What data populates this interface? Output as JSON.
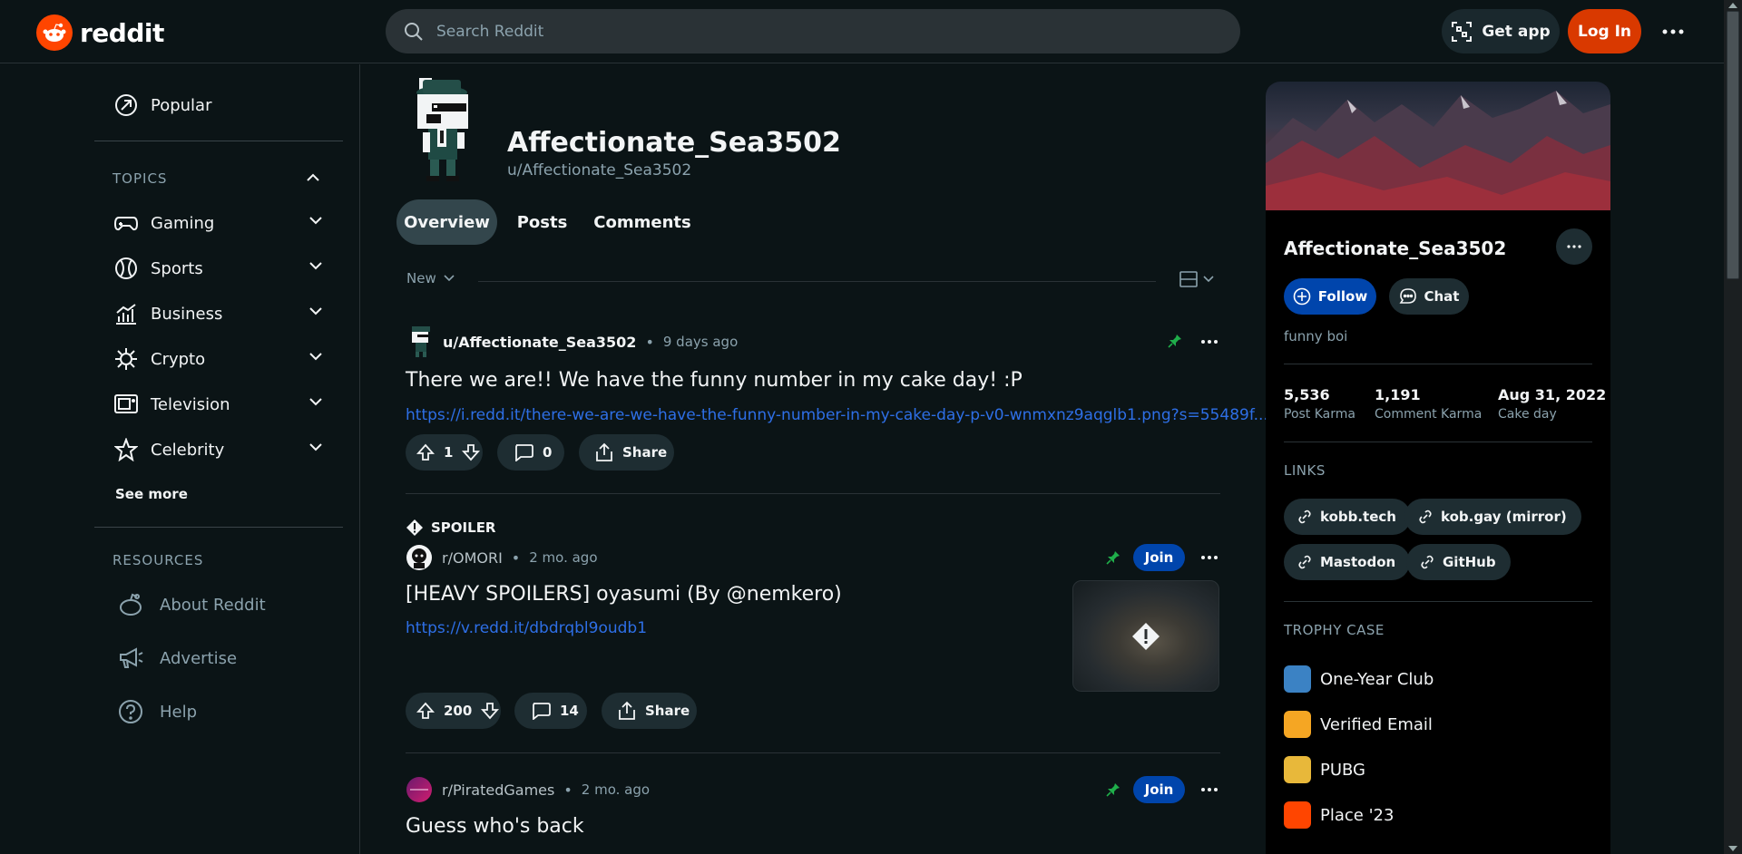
{
  "header": {
    "logo_text": "reddit",
    "search_placeholder": "Search Reddit",
    "get_app_label": "Get app",
    "login_label": "Log In"
  },
  "sidebar": {
    "popular_label": "Popular",
    "topics_heading": "TOPICS",
    "topics": [
      {
        "label": "Gaming",
        "icon": "gamepad-icon"
      },
      {
        "label": "Sports",
        "icon": "ball-icon"
      },
      {
        "label": "Business",
        "icon": "chart-icon"
      },
      {
        "label": "Crypto",
        "icon": "crypto-icon"
      },
      {
        "label": "Television",
        "icon": "tv-icon"
      },
      {
        "label": "Celebrity",
        "icon": "star-icon"
      }
    ],
    "see_more_label": "See more",
    "resources_heading": "RESOURCES",
    "resources": [
      {
        "label": "About Reddit",
        "icon": "reddit-alien-icon"
      },
      {
        "label": "Advertise",
        "icon": "megaphone-icon"
      },
      {
        "label": "Help",
        "icon": "help-icon"
      }
    ]
  },
  "profile": {
    "display_name": "Affectionate_Sea3502",
    "handle": "u/Affectionate_Sea3502",
    "tabs": [
      "Overview",
      "Posts",
      "Comments"
    ],
    "active_tab": "Overview",
    "sort_label": "New"
  },
  "posts": [
    {
      "author": "u/Affectionate_Sea3502",
      "time": "9 days ago",
      "title": "There we are!! We have the funny number in my cake day! :P",
      "link": "https://i.redd.it/there-we-are-we-have-the-funny-number-in-my-cake-day-p-v0-wnmxnz9aqglb1.png?s=55489f...",
      "votes": "1",
      "comments": "0",
      "share_label": "Share"
    },
    {
      "spoiler_label": "SPOILER",
      "subreddit": "r/OMORI",
      "time": "2 mo. ago",
      "title": "[HEAVY SPOILERS] oyasumi (By @nemkero)",
      "link": "https://v.redd.it/dbdrqbl9oudb1",
      "votes": "200",
      "comments": "14",
      "share_label": "Share",
      "join_label": "Join"
    },
    {
      "subreddit": "r/PiratedGames",
      "time": "2 mo. ago",
      "title": "Guess who's back",
      "join_label": "Join"
    }
  ],
  "card": {
    "name": "Affectionate_Sea3502",
    "follow_label": "Follow",
    "chat_label": "Chat",
    "bio": "funny boi",
    "stats": [
      {
        "value": "5,536",
        "label": "Post Karma"
      },
      {
        "value": "1,191",
        "label": "Comment Karma"
      },
      {
        "value": "Aug 31, 2022",
        "label": "Cake day"
      }
    ],
    "links_heading": "LINKS",
    "links": [
      "kobb.tech",
      "kob.gay (mirror)",
      "Mastodon",
      "GitHub"
    ],
    "trophy_heading": "TROPHY CASE",
    "trophies": [
      {
        "label": "One-Year Club",
        "color": "#3b82c4"
      },
      {
        "label": "Verified Email",
        "color": "#f5a623"
      },
      {
        "label": "PUBG",
        "color": "#e8b83a"
      },
      {
        "label": "Place '23",
        "color": "#ff4500"
      }
    ]
  },
  "colors": {
    "background": "#0b1416",
    "accent": "#ff4500",
    "link": "#2e6fe6",
    "join": "#0045ac",
    "pin": "#1fae4a"
  }
}
